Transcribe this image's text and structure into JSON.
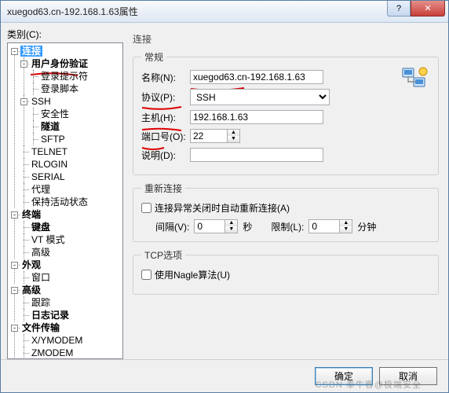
{
  "title": "xuegod63.cn-192.168.1.63属性",
  "category_label": "类别(C):",
  "tree": {
    "root": "连接",
    "auth": "用户身份验证",
    "prompt": "登录提示符",
    "script": "登录脚本",
    "ssh": "SSH",
    "security": "安全性",
    "tunnel": "隧道",
    "sftp": "SFTP",
    "telnet": "TELNET",
    "rlogin": "RLOGIN",
    "serial": "SERIAL",
    "proxy": "代理",
    "keepalive": "保持活动状态",
    "terminal": "终端",
    "keyboard": "键盘",
    "vt": "VT 模式",
    "advanced1": "高级",
    "appearance": "外观",
    "window": "窗口",
    "advanced2": "高级",
    "trace": "跟踪",
    "log": "日志记录",
    "filetransfer": "文件传输",
    "xymodem": "X/YMODEM",
    "zmodem": "ZMODEM"
  },
  "panel_heading": "连接",
  "groups": {
    "general": "常规",
    "reconnect": "重新连接",
    "tcp": "TCP选项"
  },
  "fields": {
    "name_label": "名称(N):",
    "name_value": "xuegod63.cn-192.168.1.63",
    "protocol_label": "协议(P):",
    "protocol_value": "SSH",
    "host_label": "主机(H):",
    "host_value": "192.168.1.63",
    "port_label": "端口号(O):",
    "port_value": "22",
    "desc_label": "说明(D):"
  },
  "reconnect": {
    "checkbox": "连接异常关闭时自动重新连接(A)",
    "interval_label": "间隔(V):",
    "interval_value": "0",
    "sec": "秒",
    "limit_label": "限制(L):",
    "limit_value": "0",
    "min": "分钟"
  },
  "tcp": {
    "nagle": "使用Nagle算法(U)"
  },
  "buttons": {
    "ok": "确定",
    "cancel": "取消"
  },
  "watermark": "CSDN 奉牛客@极端安全"
}
